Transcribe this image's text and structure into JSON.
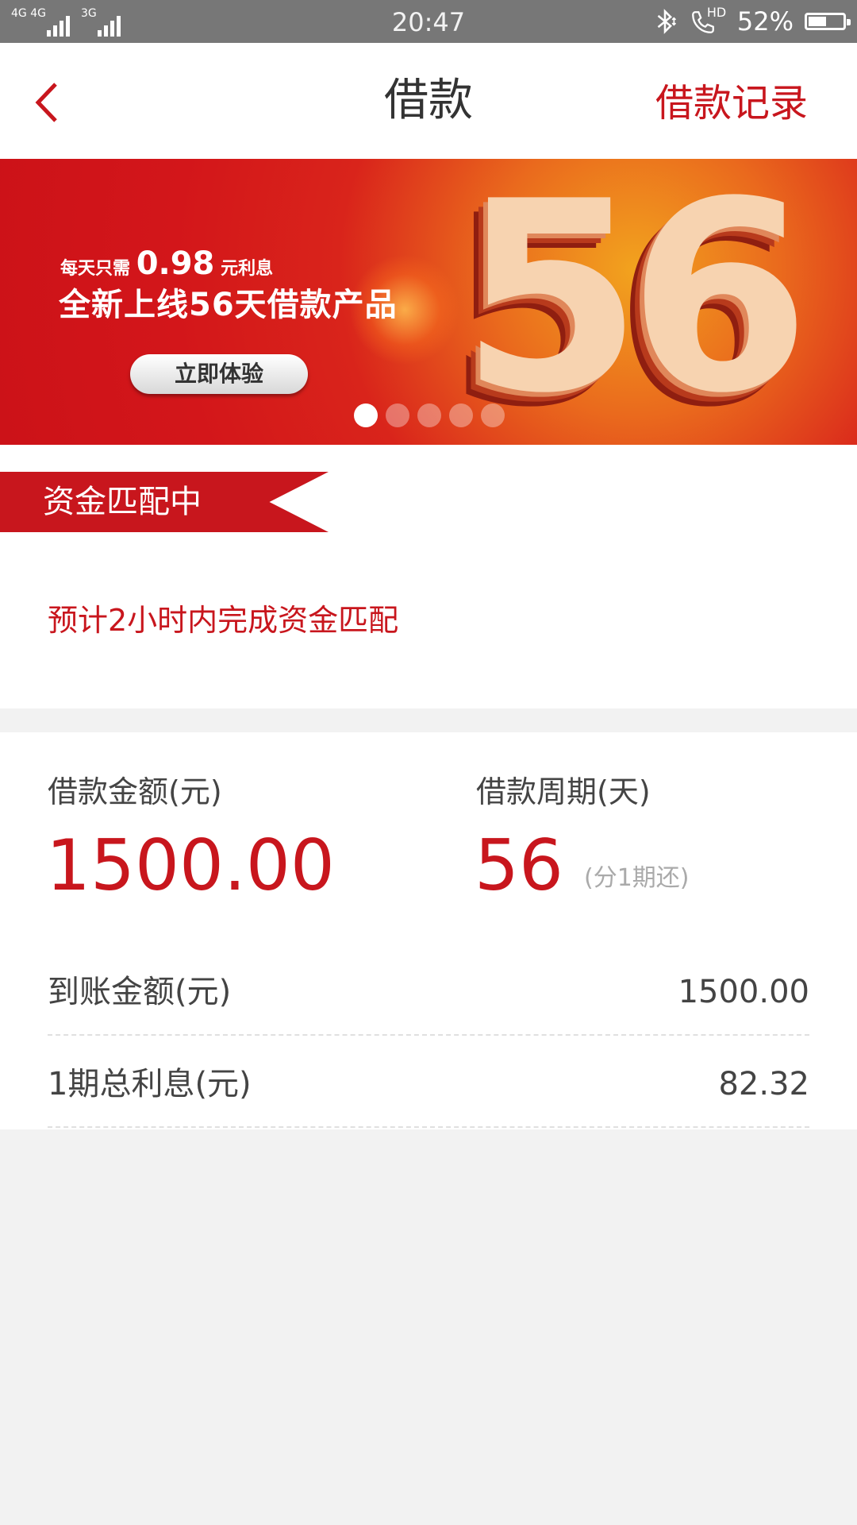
{
  "status_bar": {
    "signal1_label": "4G 4G",
    "signal2_label": "3G",
    "time": "20:47",
    "icons": [
      "bluetooth-icon",
      "hd-call-icon"
    ],
    "hd_label": "HD",
    "battery_percent": "52%",
    "battery_level": 0.52
  },
  "nav": {
    "back_icon": "chevron-left-icon",
    "title": "借款",
    "right_link": "借款记录"
  },
  "banner": {
    "line1_prefix": "每天只需",
    "line1_amount": "0.98",
    "line1_suffix": "元利息",
    "line2": "全新上线56天借款产品",
    "button": "立即体验",
    "big_number": "56",
    "dots": {
      "count": 5,
      "active": 0
    }
  },
  "status": {
    "ribbon": "资金匹配中",
    "eta": "预计2小时内完成资金匹配"
  },
  "loan": {
    "amount_label": "借款金额(元)",
    "amount": "1500.00",
    "period_label": "借款周期(天)",
    "period": "56",
    "period_note": "(分1期还)",
    "rows": [
      {
        "label": "到账金额(元)",
        "value": "1500.00"
      },
      {
        "label": "1期总利息(元)",
        "value": "82.32"
      }
    ]
  },
  "colors": {
    "accent": "#c8161d",
    "status_bar": "#777777",
    "page_bg": "#f2f2f2"
  }
}
